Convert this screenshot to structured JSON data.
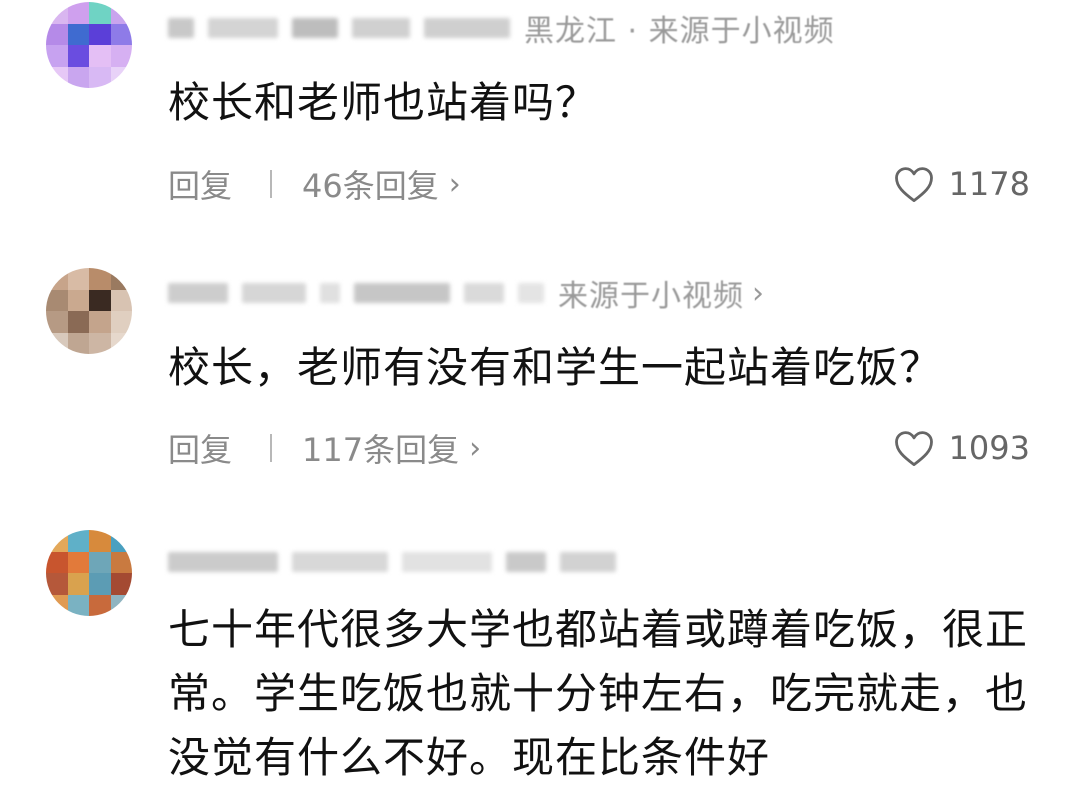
{
  "comments": [
    {
      "meta_text": "黑龙江 · 来源于小视频",
      "text": "校长和老师也站着吗？",
      "reply_label": "回复",
      "replies_label": "46条回复",
      "likes": "1178",
      "avatar_colors": [
        "#d9b6f0",
        "#cfa0ee",
        "#6fd3c4",
        "#c9a4ee",
        "#b58ae8",
        "#3f6bd0",
        "#5b3fd8",
        "#8e7be8",
        "#c7a2f0",
        "#6a4de0",
        "#e4bff5",
        "#d6b0f2",
        "#e6c8f6",
        "#c9a6ef",
        "#d8b9f4",
        "#e8d2f8"
      ]
    },
    {
      "meta_text": "来源于小视频",
      "text": "校长，老师有没有和学生一起站着吃饭？",
      "reply_label": "回复",
      "replies_label": "117条回复",
      "likes": "1093",
      "avatar_colors": [
        "#c7a48a",
        "#d8bba5",
        "#b88c6a",
        "#9a7a60",
        "#a88a72",
        "#caa98f",
        "#3a2a22",
        "#d8c3b2",
        "#b69a84",
        "#8a6a55",
        "#c4a48c",
        "#e0cfc0",
        "#d8c9bc",
        "#bfa692",
        "#cdb6a4",
        "#e6d8cc"
      ]
    },
    {
      "meta_text": "",
      "text": "七十年代很多大学也都站着或蹲着吃饭，很正常。学生吃饭也就十分钟左右，吃完就走，也没觉有什么不好。现在比条件好",
      "avatar_colors": [
        "#e3a85a",
        "#5fb0c8",
        "#d78a3c",
        "#4aa0c0",
        "#c8552e",
        "#e27a3a",
        "#6ea6b8",
        "#c97a40",
        "#b5583a",
        "#d9a24e",
        "#5c9cb4",
        "#a44a32",
        "#e09a52",
        "#7ab2c2",
        "#c86a3c",
        "#8fb4c0"
      ]
    }
  ]
}
